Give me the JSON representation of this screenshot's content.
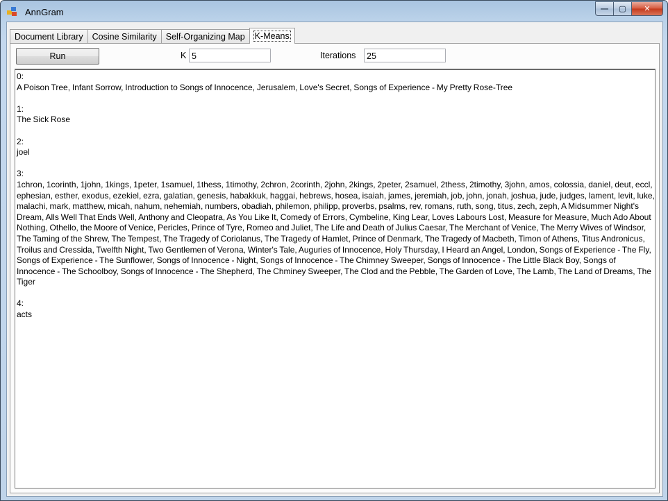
{
  "window": {
    "title": "AnnGram",
    "caption_buttons": {
      "minimize": "—",
      "maximize": "▢",
      "close": "✕"
    }
  },
  "tabs": [
    {
      "label": "Document Library",
      "active": false
    },
    {
      "label": "Cosine Similarity",
      "active": false
    },
    {
      "label": "Self-Organizing Map",
      "active": false
    },
    {
      "label": "K-Means",
      "active": true
    }
  ],
  "kmeans": {
    "run_label": "Run",
    "k_label": "K",
    "k_value": "5",
    "iterations_label": "Iterations",
    "iterations_value": "25"
  },
  "output": {
    "clusters": [
      {
        "header": "0:",
        "items": "A Poison Tree, Infant Sorrow, Introduction to Songs of Innocence, Jerusalem, Love's Secret, Songs of Experience - My Pretty Rose-Tree"
      },
      {
        "header": "1:",
        "items": "The Sick Rose"
      },
      {
        "header": "2:",
        "items": "joel"
      },
      {
        "header": "3:",
        "items": "1chron, 1corinth, 1john, 1kings, 1peter, 1samuel, 1thess, 1timothy, 2chron, 2corinth, 2john, 2kings, 2peter, 2samuel, 2thess, 2timothy, 3john, amos, colossia, daniel, deut, eccl, ephesian, esther, exodus, ezekiel, ezra, galatian, genesis, habakkuk, haggai, hebrews, hosea, isaiah, james, jeremiah, job, john, jonah, joshua, jude, judges, lament, levit, luke, malachi, mark, matthew, micah, nahum, nehemiah, numbers, obadiah, philemon, philipp, proverbs, psalms, rev, romans, ruth, song, titus, zech, zeph, A Midsummer Night's Dream, Alls Well That Ends Well, Anthony and Cleopatra, As You Like It, Comedy of Errors, Cymbeline, King Lear, Loves Labours Lost, Measure for Measure, Much Ado About Nothing, Othello, the Moore of Venice, Pericles, Prince of Tyre, Romeo and Juliet, The Life and Death of Julius Caesar, The Merchant of Venice, The Merry Wives of Windsor, The Taming of the Shrew, The Tempest, The Tragedy of Coriolanus, The Tragedy of Hamlet, Prince of Denmark, The Tragedy of Macbeth, Timon of Athens, Titus Andronicus, Troilus and Cressida, Twelfth Night, Two Gentlemen of Verona, Winter's Tale, Auguries of Innocence, Holy Thursday, I Heard an Angel, London, Songs of Experience - The Fly, Songs of Experience - The Sunflower, Songs of Innocence - Night, Songs of Innocence - The Chimney Sweeper, Songs of Innocence - The Little Black Boy, Songs of Innocence - The Schoolboy, Songs of Innocence - The Shepherd, The Chminey Sweeper, The Clod and the Pebble, The Garden of Love, The Lamb, The Land of Dreams, The Tiger"
      },
      {
        "header": "4:",
        "items": "acts"
      }
    ]
  },
  "colors": {
    "title_bar": "#bcd3ea",
    "client_bg": "#f0f0f0",
    "close_button": "#c43a1c"
  },
  "icons": {
    "app": "app-icon",
    "minimize": "minimize-icon",
    "maximize": "maximize-icon",
    "close": "close-icon"
  }
}
